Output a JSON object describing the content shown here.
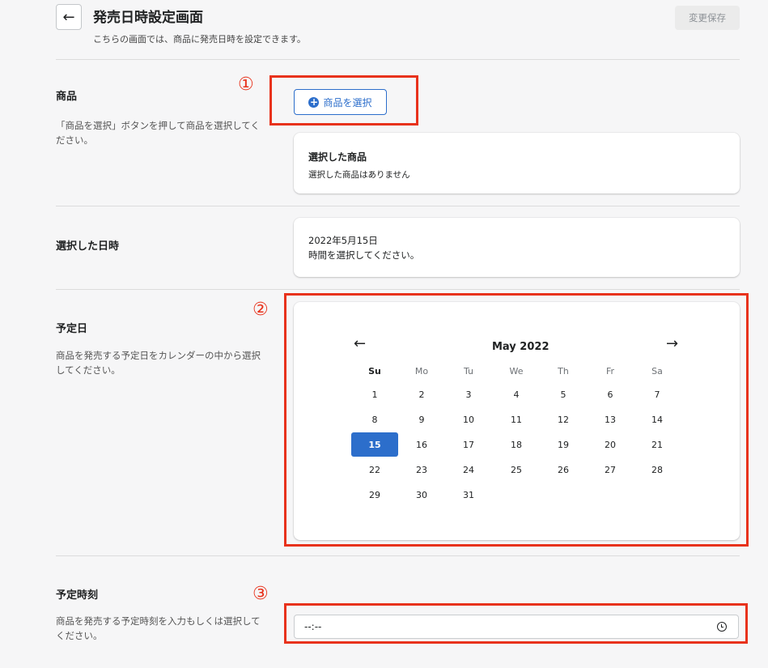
{
  "header": {
    "title": "発売日時設定画面",
    "subtitle": "こちらの画面では、商品に発売日時を設定できます。",
    "save_label": "変更保存",
    "back_icon": "←"
  },
  "product": {
    "title": "商品",
    "desc": "「商品を選択」ボタンを押して商品を選択してください。",
    "select_label": "商品を選択",
    "selected_title": "選択した商品",
    "selected_text": "選択した商品はありません"
  },
  "selected_datetime": {
    "title": "選択した日時",
    "date": "2022年5月15日",
    "time_text": "時間を選択してください。"
  },
  "date": {
    "title": "予定日",
    "desc": "商品を発売する予定日をカレンダーの中から選択してください。"
  },
  "calendar": {
    "month": "May 2022",
    "prev": "←",
    "next": "→",
    "weekdays": [
      "Su",
      "Mo",
      "Tu",
      "We",
      "Th",
      "Fr",
      "Sa"
    ],
    "weeks": [
      [
        "1",
        "2",
        "3",
        "4",
        "5",
        "6",
        "7"
      ],
      [
        "8",
        "9",
        "10",
        "11",
        "12",
        "13",
        "14"
      ],
      [
        "15",
        "16",
        "17",
        "18",
        "19",
        "20",
        "21"
      ],
      [
        "22",
        "23",
        "24",
        "25",
        "26",
        "27",
        "28"
      ],
      [
        "29",
        "30",
        "31",
        "",
        "",
        "",
        ""
      ]
    ],
    "selected": "15"
  },
  "time": {
    "title": "予定時刻",
    "desc": "商品を発売する予定時刻を入力もしくは選択してください。",
    "value": "--:--"
  },
  "markers": {
    "one": "①",
    "two": "②",
    "three": "③"
  },
  "colors": {
    "accent": "#2c6ecb",
    "highlight": "#e8321c"
  }
}
